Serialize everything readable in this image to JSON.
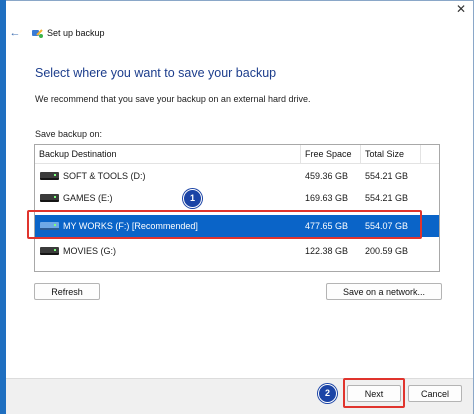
{
  "window": {
    "title": "Set up backup",
    "close_glyph": "✕",
    "back_glyph": "←"
  },
  "main": {
    "heading": "Select where you want to save your backup",
    "description": "We recommend that you save your backup on an external hard drive.",
    "save_on_label": "Save backup on:"
  },
  "table": {
    "columns": [
      "Backup Destination",
      "Free Space",
      "Total Size"
    ],
    "rows": [
      {
        "name": "SOFT & TOOLS (D:)",
        "free": "459.36 GB",
        "total": "554.21 GB",
        "selected": false,
        "icon": "hard-drive-icon"
      },
      {
        "name": "GAMES (E:)",
        "free": "169.63 GB",
        "total": "554.21 GB",
        "selected": false,
        "icon": "hard-drive-icon"
      },
      {
        "name": "MY WORKS (F:) [Recommended]",
        "free": "477.65 GB",
        "total": "554.07 GB",
        "selected": true,
        "icon": "hard-drive-icon"
      },
      {
        "name": "MOVIES (G:)",
        "free": "122.38 GB",
        "total": "200.59 GB",
        "selected": false,
        "icon": "hard-drive-icon"
      }
    ]
  },
  "buttons": {
    "refresh": "Refresh",
    "save_on_network": "Save on a network...",
    "next": "Next",
    "cancel": "Cancel"
  },
  "annotations": {
    "step1": "1",
    "step2": "2"
  },
  "colors": {
    "accent": "#0a64c8",
    "highlight": "#e0342d",
    "heading": "#1c3d8c",
    "badge": "#1b44a6"
  }
}
